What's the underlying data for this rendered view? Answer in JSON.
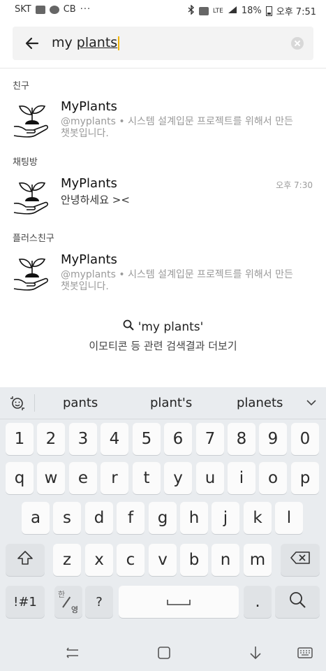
{
  "status_bar": {
    "carrier": "SKT",
    "cb": "CB",
    "dots": "···",
    "lte": "LTE",
    "battery": "18%",
    "time": "오후 7:51"
  },
  "search": {
    "query_prefix": "my ",
    "query_word": "plants"
  },
  "sections": [
    {
      "label": "친구",
      "name": "MyPlants",
      "desc": "@myplants • 시스템 설계입문 프로젝트를 위해서 만든 챗봇입니다."
    },
    {
      "label": "채팅방",
      "name": "MyPlants",
      "message": "안녕하세요 ><",
      "time": "오후 7:30"
    },
    {
      "label": "플러스친구",
      "name": "MyPlants",
      "desc": "@myplants • 시스템 설계입문 프로젝트를 위해서 만든 챗봇입니다."
    }
  ],
  "more": {
    "query": "'my plants'",
    "subtitle": "이모티콘 등 관련 검색결과 더보기"
  },
  "keyboard": {
    "suggestions": [
      "pants",
      "plant's",
      "planets"
    ],
    "rows": [
      [
        "1",
        "2",
        "3",
        "4",
        "5",
        "6",
        "7",
        "8",
        "9",
        "0"
      ],
      [
        "q",
        "w",
        "e",
        "r",
        "t",
        "y",
        "u",
        "i",
        "o",
        "p"
      ],
      [
        "a",
        "s",
        "d",
        "f",
        "g",
        "h",
        "j",
        "k",
        "l"
      ],
      [
        "z",
        "x",
        "c",
        "v",
        "b",
        "n",
        "m"
      ]
    ],
    "symbols": "!#1",
    "lang_top": "한",
    "lang_bottom": "영",
    "question": "?",
    "period": "."
  },
  "icons": {
    "back": "arrow-left-icon",
    "clear": "clear-circle-icon",
    "search": "magnifier-icon",
    "shift": "shift-arrow-icon",
    "backspace": "backspace-icon",
    "space": "space-icon",
    "search_key": "magnifier-icon"
  }
}
